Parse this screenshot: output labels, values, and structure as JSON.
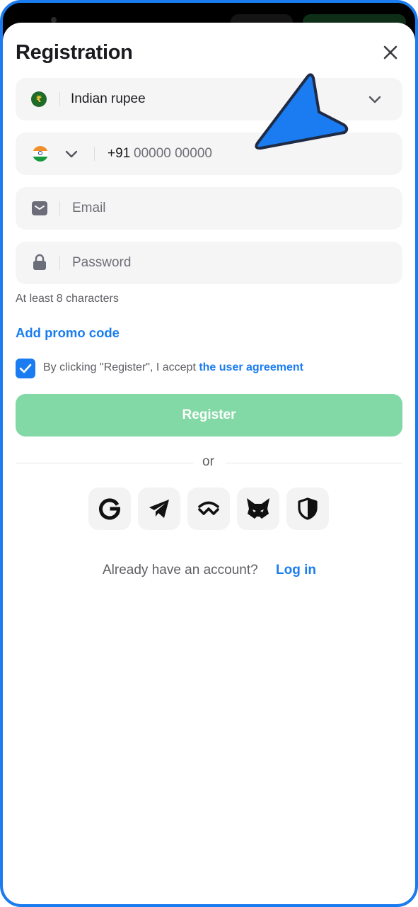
{
  "header": {
    "title": "Registration"
  },
  "currency": {
    "icon_symbol": "₹",
    "label": "Indian rupee"
  },
  "phone": {
    "code": "+91",
    "placeholder": "00000 00000"
  },
  "email": {
    "placeholder": "Email"
  },
  "password": {
    "placeholder": "Password",
    "hint": "At least 8 characters"
  },
  "promo": {
    "label": "Add promo code"
  },
  "agreement": {
    "text": "By clicking \"Register\", I accept ",
    "link": "the user agreement",
    "checked": true
  },
  "register": {
    "label": "Register"
  },
  "divider": {
    "label": "or"
  },
  "social": [
    {
      "name": "google-icon"
    },
    {
      "name": "telegram-icon"
    },
    {
      "name": "walletconnect-icon"
    },
    {
      "name": "metamask-icon"
    },
    {
      "name": "shield-icon"
    }
  ],
  "footer": {
    "question": "Already have an account?",
    "login": "Log in"
  },
  "colors": {
    "accent": "#1a7cf0",
    "register_bg": "#82d9a6",
    "field_bg": "#f5f5f6",
    "frame": "#1a7cf0"
  }
}
